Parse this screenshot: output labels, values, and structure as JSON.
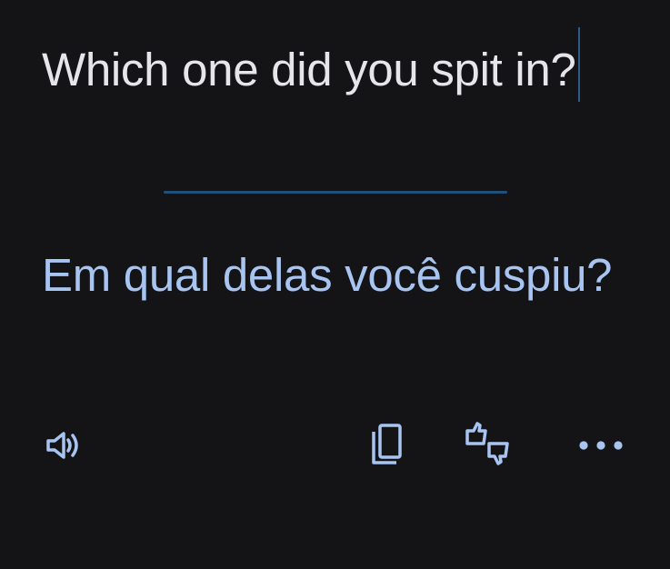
{
  "source": {
    "text": "Which one did you spit in?"
  },
  "translation": {
    "text": "Em qual delas você cuspiu?"
  },
  "actions": {
    "speak_icon": "speaker-icon",
    "copy_icon": "copy-icon",
    "feedback_icon": "thumbs-feedback-icon",
    "more_icon": "more-horizontal-icon"
  },
  "colors": {
    "background": "#141417",
    "source_text": "#e6e6ea",
    "translation_text": "#a8c4f0",
    "divider": "#1e5079",
    "icon": "#a8c4f0"
  }
}
